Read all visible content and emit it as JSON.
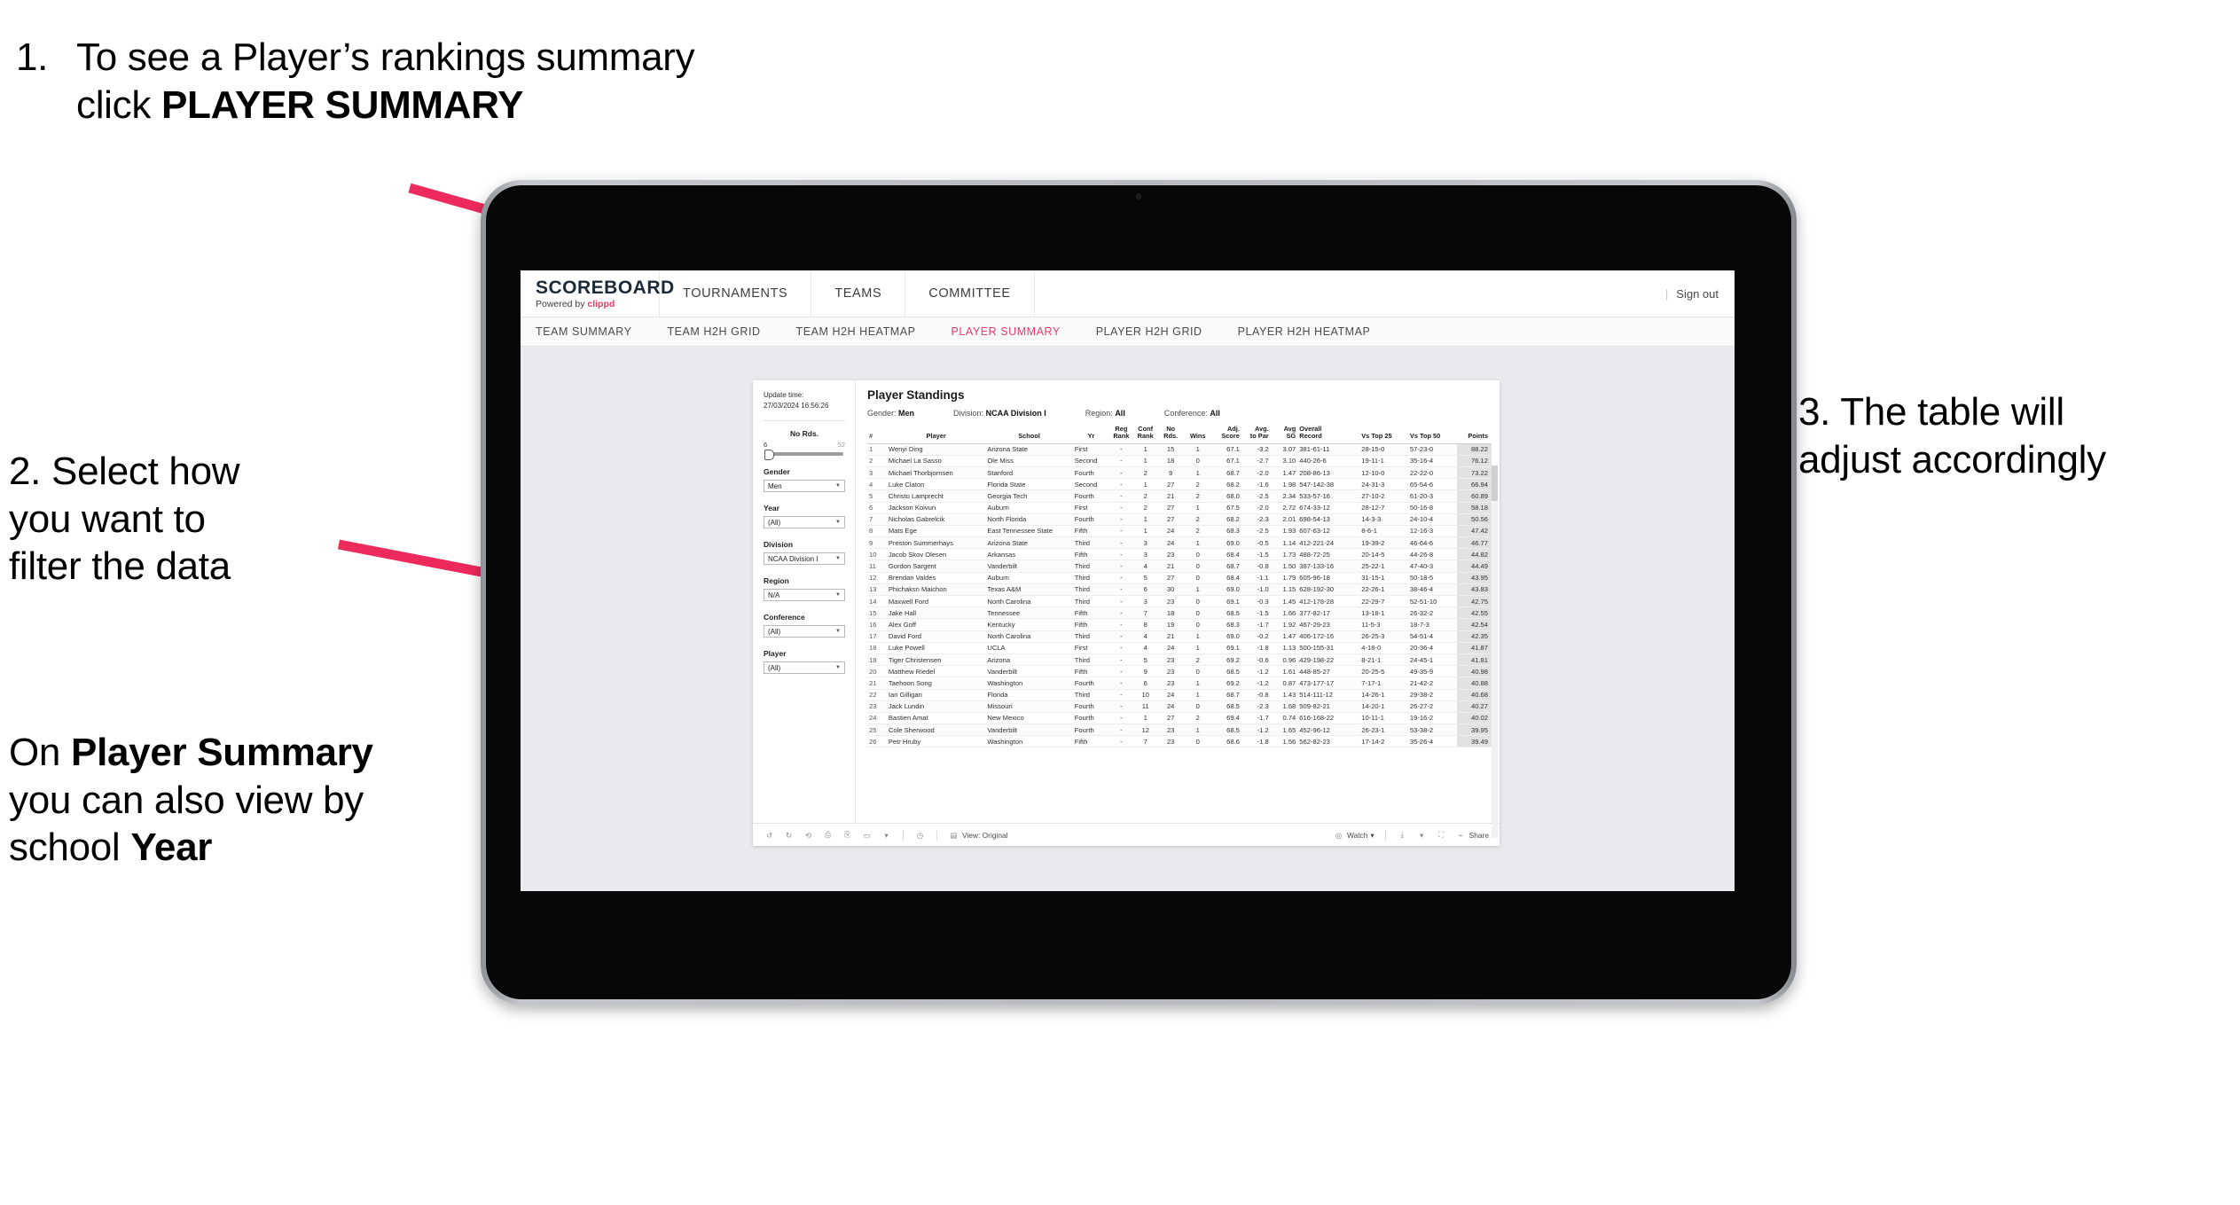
{
  "annotations": {
    "step1_num": "1.",
    "step1_text_a": "To see a Player’s rankings summary click ",
    "step1_bold": "PLAYER SUMMARY",
    "step2_line1": "2. Select how",
    "step2_line2": "you want to",
    "step2_line3": "filter the data",
    "step2b_a": "On ",
    "step2b_bold1": "Player Summary",
    "step2b_b": " you can also view by school ",
    "step2b_bold2": "Year",
    "step3_line1": "3. The table will",
    "step3_line2": "adjust accordingly"
  },
  "colors": {
    "accent_pink": "#EE3A68",
    "arrow_pink": "#EC2A5B",
    "brand_dark": "#1C2B3A"
  },
  "app": {
    "logo_main": "SCOREBOARD",
    "logo_sub_prefix": "Powered by ",
    "logo_sub_brand": "clippd",
    "header_nav": [
      "TOURNAMENTS",
      "TEAMS",
      "COMMITTEE"
    ],
    "header_right": {
      "divider": "|",
      "sign_out": "Sign out"
    },
    "sub_nav": [
      {
        "label": "TEAM SUMMARY",
        "active": false
      },
      {
        "label": "TEAM H2H GRID",
        "active": false
      },
      {
        "label": "TEAM H2H HEATMAP",
        "active": false
      },
      {
        "label": "PLAYER SUMMARY",
        "active": true
      },
      {
        "label": "PLAYER H2H GRID",
        "active": false
      },
      {
        "label": "PLAYER H2H HEATMAP",
        "active": false
      }
    ]
  },
  "filters": {
    "update_label": "Update time:",
    "update_value": "27/03/2024 16:56:26",
    "slider": {
      "title": "No Rds.",
      "min": "6",
      "max": "52"
    },
    "fields": [
      {
        "title": "Gender",
        "value": "Men"
      },
      {
        "title": "Year",
        "value": "(All)"
      },
      {
        "title": "Division",
        "value": "NCAA Division I"
      },
      {
        "title": "Region",
        "value": "N/A"
      },
      {
        "title": "Conference",
        "value": "(All)"
      },
      {
        "title": "Player",
        "value": "(All)"
      }
    ]
  },
  "viz": {
    "title": "Player Standings",
    "meta": [
      {
        "label": "Gender:",
        "value": "Men"
      },
      {
        "label": "Division:",
        "value": "NCAA Division I"
      },
      {
        "label": "Region:",
        "value": "All"
      },
      {
        "label": "Conference:",
        "value": "All"
      }
    ],
    "columns": [
      {
        "l1": "#",
        "l2": ""
      },
      {
        "l1": "Player",
        "l2": ""
      },
      {
        "l1": "School",
        "l2": ""
      },
      {
        "l1": "Yr",
        "l2": ""
      },
      {
        "l1": "Reg",
        "l2": "Rank"
      },
      {
        "l1": "Conf",
        "l2": "Rank"
      },
      {
        "l1": "No",
        "l2": "Rds."
      },
      {
        "l1": "Wins",
        "l2": ""
      },
      {
        "l1": "Adj.",
        "l2": "Score"
      },
      {
        "l1": "Avg.",
        "l2": "to Par"
      },
      {
        "l1": "Avg",
        "l2": "SG"
      },
      {
        "l1": "Overall",
        "l2": "Record"
      },
      {
        "l1": "Vs Top 25",
        "l2": ""
      },
      {
        "l1": "Vs Top 50",
        "l2": ""
      },
      {
        "l1": "Points",
        "l2": ""
      }
    ],
    "rows": [
      [
        "1",
        "Wenyi Ding",
        "Arizona State",
        "First",
        "-",
        "1",
        "15",
        "1",
        "67.1",
        "-3.2",
        "3.07",
        "381-61-11",
        "28-15-0",
        "57-23-0",
        "88.22"
      ],
      [
        "2",
        "Michael La Sasso",
        "Ole Miss",
        "Second",
        "-",
        "1",
        "18",
        "0",
        "67.1",
        "-2.7",
        "3.10",
        "440-26-6",
        "19-11-1",
        "35-16-4",
        "76.12"
      ],
      [
        "3",
        "Michael Thorbjornsen",
        "Stanford",
        "Fourth",
        "-",
        "2",
        "9",
        "1",
        "68.7",
        "-2.0",
        "1.47",
        "208-86-13",
        "12-10-0",
        "22-22-0",
        "73.22"
      ],
      [
        "4",
        "Luke Claton",
        "Florida State",
        "Second",
        "-",
        "1",
        "27",
        "2",
        "68.2",
        "-1.6",
        "1.98",
        "547-142-38",
        "24-31-3",
        "65-54-6",
        "66.94"
      ],
      [
        "5",
        "Christo Lamprecht",
        "Georgia Tech",
        "Fourth",
        "-",
        "2",
        "21",
        "2",
        "68.0",
        "-2.5",
        "2.34",
        "533-57-16",
        "27-10-2",
        "61-20-3",
        "60.89"
      ],
      [
        "6",
        "Jackson Koivun",
        "Auburn",
        "First",
        "-",
        "2",
        "27",
        "1",
        "67.5",
        "-2.0",
        "2.72",
        "674-33-12",
        "28-12-7",
        "50-16-8",
        "58.18"
      ],
      [
        "7",
        "Nicholas Gabrelcik",
        "North Florida",
        "Fourth",
        "-",
        "1",
        "27",
        "2",
        "68.2",
        "-2.3",
        "2.01",
        "698-54-13",
        "14-3-3",
        "24-10-4",
        "50.56"
      ],
      [
        "8",
        "Mats Ege",
        "East Tennessee State",
        "Fifth",
        "-",
        "1",
        "24",
        "2",
        "68.3",
        "-2.5",
        "1.93",
        "607-63-12",
        "8-6-1",
        "12-16-3",
        "47.42"
      ],
      [
        "9",
        "Preston Summerhays",
        "Arizona State",
        "Third",
        "-",
        "3",
        "24",
        "1",
        "69.0",
        "-0.5",
        "1.14",
        "412-221-24",
        "19-39-2",
        "46-64-6",
        "46.77"
      ],
      [
        "10",
        "Jacob Skov Olesen",
        "Arkansas",
        "Fifth",
        "-",
        "3",
        "23",
        "0",
        "68.4",
        "-1.5",
        "1.73",
        "488-72-25",
        "20-14-5",
        "44-26-8",
        "44.82"
      ],
      [
        "11",
        "Gordon Sargent",
        "Vanderbilt",
        "Third",
        "-",
        "4",
        "21",
        "0",
        "68.7",
        "-0.8",
        "1.50",
        "387-133-16",
        "25-22-1",
        "47-40-3",
        "44.49"
      ],
      [
        "12",
        "Brendan Valdes",
        "Auburn",
        "Third",
        "-",
        "5",
        "27",
        "0",
        "68.4",
        "-1.1",
        "1.79",
        "605-96-18",
        "31-15-1",
        "50-18-5",
        "43.95"
      ],
      [
        "13",
        "Phichaksn Maichon",
        "Texas A&M",
        "Third",
        "-",
        "6",
        "30",
        "1",
        "69.0",
        "-1.0",
        "1.15",
        "628-192-30",
        "22-26-1",
        "38-46-4",
        "43.83"
      ],
      [
        "14",
        "Maxwell Ford",
        "North Carolina",
        "Third",
        "-",
        "3",
        "23",
        "0",
        "69.1",
        "-0.3",
        "1.45",
        "412-178-28",
        "22-29-7",
        "52-51-10",
        "42.75"
      ],
      [
        "15",
        "Jake Hall",
        "Tennessee",
        "Fifth",
        "-",
        "7",
        "18",
        "0",
        "68.5",
        "-1.5",
        "1.66",
        "377-82-17",
        "13-18-1",
        "26-32-2",
        "42.55"
      ],
      [
        "16",
        "Alex Goff",
        "Kentucky",
        "Fifth",
        "-",
        "8",
        "19",
        "0",
        "68.3",
        "-1.7",
        "1.92",
        "467-29-23",
        "11-5-3",
        "18-7-3",
        "42.54"
      ],
      [
        "17",
        "David Ford",
        "North Carolina",
        "Third",
        "-",
        "4",
        "21",
        "1",
        "69.0",
        "-0.2",
        "1.47",
        "406-172-16",
        "26-25-3",
        "54-51-4",
        "42.35"
      ],
      [
        "18",
        "Luke Powell",
        "UCLA",
        "First",
        "-",
        "4",
        "24",
        "1",
        "69.1",
        "-1.8",
        "1.13",
        "500-155-31",
        "4-18-0",
        "20-36-4",
        "41.87"
      ],
      [
        "19",
        "Tiger Christensen",
        "Arizona",
        "Third",
        "-",
        "5",
        "23",
        "2",
        "69.2",
        "-0.6",
        "0.96",
        "429-198-22",
        "8-21-1",
        "24-45-1",
        "41.81"
      ],
      [
        "20",
        "Matthew Riedel",
        "Vanderbilt",
        "Fifth",
        "-",
        "9",
        "23",
        "0",
        "68.5",
        "-1.2",
        "1.61",
        "448-85-27",
        "20-25-5",
        "49-35-9",
        "40.98"
      ],
      [
        "21",
        "Taehoon Song",
        "Washington",
        "Fourth",
        "-",
        "6",
        "23",
        "1",
        "69.2",
        "-1.2",
        "0.87",
        "473-177-17",
        "7-17-1",
        "21-42-2",
        "40.88"
      ],
      [
        "22",
        "Ian Gilligan",
        "Florida",
        "Third",
        "-",
        "10",
        "24",
        "1",
        "68.7",
        "-0.8",
        "1.43",
        "514-111-12",
        "14-26-1",
        "29-38-2",
        "40.68"
      ],
      [
        "23",
        "Jack Lundin",
        "Missouri",
        "Fourth",
        "-",
        "11",
        "24",
        "0",
        "68.5",
        "-2.3",
        "1.68",
        "509-82-21",
        "14-20-1",
        "26-27-2",
        "40.27"
      ],
      [
        "24",
        "Bastien Amat",
        "New Mexico",
        "Fourth",
        "-",
        "1",
        "27",
        "2",
        "69.4",
        "-1.7",
        "0.74",
        "616-168-22",
        "10-11-1",
        "19-16-2",
        "40.02"
      ],
      [
        "25",
        "Cole Sherwood",
        "Vanderbilt",
        "Fourth",
        "-",
        "12",
        "23",
        "1",
        "68.5",
        "-1.2",
        "1.65",
        "452-96-12",
        "26-23-1",
        "53-38-2",
        "39.95"
      ],
      [
        "26",
        "Petr Hruby",
        "Washington",
        "Fifth",
        "-",
        "7",
        "23",
        "0",
        "68.6",
        "-1.8",
        "1.56",
        "562-82-23",
        "17-14-2",
        "35-26-4",
        "39.49"
      ]
    ]
  },
  "toolbar": {
    "undo": "undo-icon",
    "redo": "redo-icon",
    "reset": "reset-icon",
    "pause": "pause-icon",
    "refresh": "refresh-icon",
    "view_label": "View: Original",
    "watch_label": "Watch",
    "share_label": "Share"
  }
}
